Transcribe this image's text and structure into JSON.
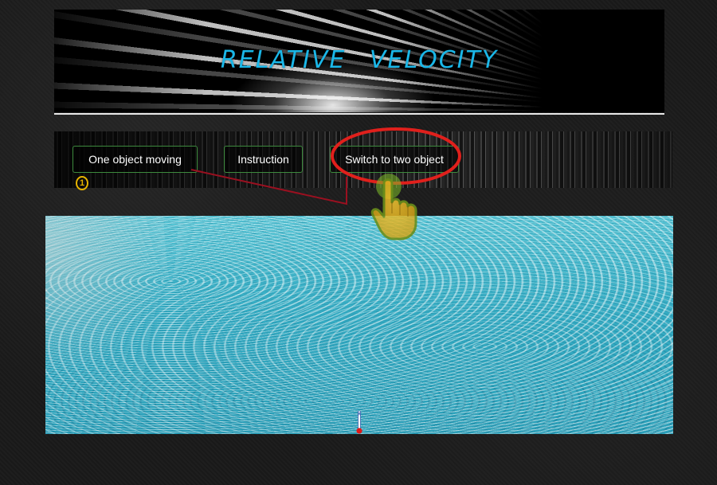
{
  "banner": {
    "title": "RELATIVE   VELOCITY"
  },
  "nav": {
    "one_object": "One object moving",
    "instruction": "Instruction",
    "switch_two": "Switch to two object"
  },
  "annotation": {
    "step_number": "1"
  },
  "colors": {
    "title": "#1ab7e8",
    "button_border": "#3d8a3d",
    "highlight_ellipse": "#e0201c",
    "connector": "#9a1020",
    "badge": "#e7b400",
    "water": "#3fb2c8"
  },
  "icons": [
    "pointing-hand-icon",
    "boat-marker-icon"
  ]
}
